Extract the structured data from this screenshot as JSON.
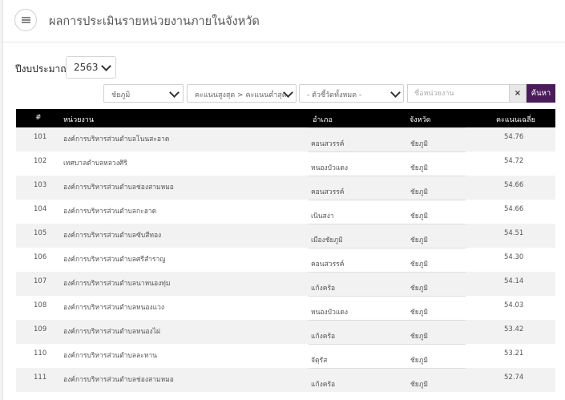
{
  "header": {
    "title": "ผลการประเมินรายหน่วยงานภายในจังหวัด"
  },
  "filters": {
    "year_label": "ปีงบประมาณ",
    "year_value": "2563",
    "province_value": "ชัยภูมิ",
    "sort_value": "คะแนนสูงสุด > คะแนนต่ำสุด",
    "indicator_value": "- ตัวชี้วัดทั้งหมด -",
    "search_placeholder": "ชื่อหน่วยงาน",
    "clear_label": "×",
    "search_label": "ค้นหา"
  },
  "table": {
    "columns": {
      "num": "#",
      "org": "หน่วยงาน",
      "amphoe": "อำเภอ",
      "province": "จังหวัด",
      "score": "คะแนนเฉลี่ย"
    },
    "rows": [
      {
        "num": "101",
        "org": "องค์การบริหารส่วนตำบลโนนสะอาด",
        "amphoe": "คอนสวรรค์",
        "province": "ชัยภูมิ",
        "score": "54.76"
      },
      {
        "num": "102",
        "org": "เทศบาลตำบลหลวงศิริ",
        "amphoe": "หนองบัวแดง",
        "province": "ชัยภูมิ",
        "score": "54.72"
      },
      {
        "num": "103",
        "org": "องค์การบริหารส่วนตำบลช่องสามหมอ",
        "amphoe": "คอนสวรรค์",
        "province": "ชัยภูมิ",
        "score": "54.66"
      },
      {
        "num": "104",
        "org": "องค์การบริหารส่วนตำบลกะฮาด",
        "amphoe": "เนินสง่า",
        "province": "ชัยภูมิ",
        "score": "54.66"
      },
      {
        "num": "105",
        "org": "องค์การบริหารส่วนตำบลซับสีทอง",
        "amphoe": "เมืองชัยภูมิ",
        "province": "ชัยภูมิ",
        "score": "54.51"
      },
      {
        "num": "106",
        "org": "องค์การบริหารส่วนตำบลศรีสำราญ",
        "amphoe": "คอนสวรรค์",
        "province": "ชัยภูมิ",
        "score": "54.30"
      },
      {
        "num": "107",
        "org": "องค์การบริหารส่วนตำบลนาหนองทุ่ม",
        "amphoe": "แก้งคร้อ",
        "province": "ชัยภูมิ",
        "score": "54.14"
      },
      {
        "num": "108",
        "org": "องค์การบริหารส่วนตำบลหนองแวง",
        "amphoe": "หนองบัวแดง",
        "province": "ชัยภูมิ",
        "score": "54.03"
      },
      {
        "num": "109",
        "org": "องค์การบริหารส่วนตำบลหนองไผ่",
        "amphoe": "แก้งคร้อ",
        "province": "ชัยภูมิ",
        "score": "53.42"
      },
      {
        "num": "110",
        "org": "องค์การบริหารส่วนตำบลละหาน",
        "amphoe": "จัตุรัส",
        "province": "ชัยภูมิ",
        "score": "53.21"
      },
      {
        "num": "111",
        "org": "องค์การบริหารส่วนตำบลช่องสามหมอ",
        "amphoe": "แก้งคร้อ",
        "province": "ชัยภูมิ",
        "score": "52.74"
      }
    ]
  }
}
